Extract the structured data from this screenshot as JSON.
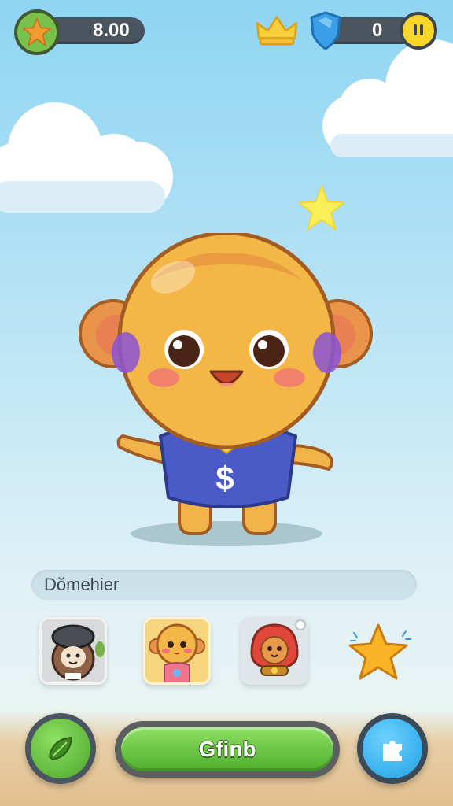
{
  "hud": {
    "coins_value": "8.00",
    "gems_value": "0",
    "left_icon": "star-badge-icon",
    "crown_icon": "crown-icon",
    "gem_icon": "shield-gem-icon",
    "smiley_icon": "smiley-coin-icon"
  },
  "character": {
    "shirt_symbol": "$"
  },
  "name_field": {
    "value": "Dŏmehier"
  },
  "character_cards": [
    {
      "name": "hat-character"
    },
    {
      "name": "monkey-character"
    },
    {
      "name": "hooded-character"
    },
    {
      "name": "star-reward"
    }
  ],
  "buttons": {
    "main_label": "Gfinb",
    "left_icon": "leaf-icon",
    "right_icon": "puzzle-icon"
  },
  "colors": {
    "accent_green": "#5cbf37",
    "accent_blue": "#2eb3ef",
    "character_body": "#f2b24a",
    "shirt_blue": "#4a5bc8"
  }
}
